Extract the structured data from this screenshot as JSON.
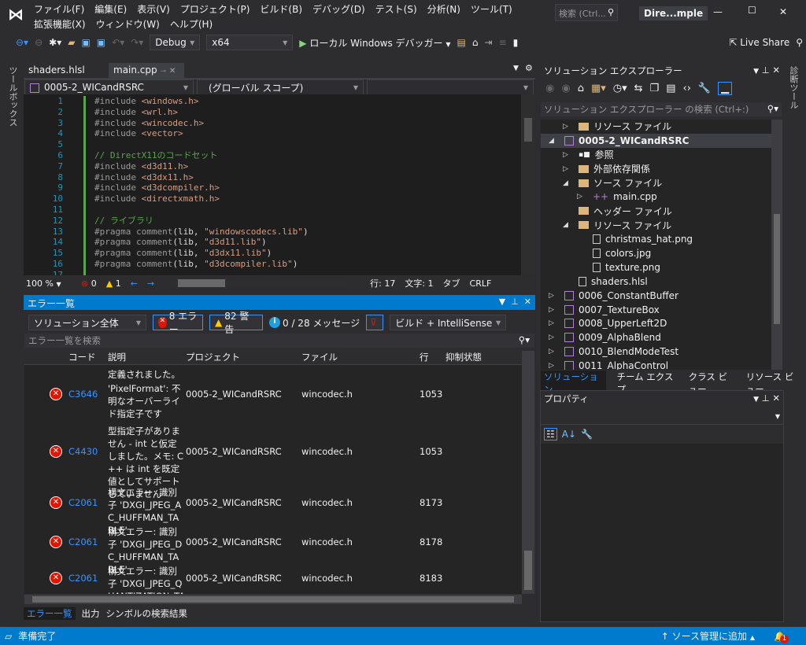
{
  "window": {
    "title": "Dire...mple",
    "search_placeholder": "検索 (Ctrl...",
    "min": "—",
    "max": "☐",
    "close": "✕"
  },
  "menu": [
    "ファイル(F)",
    "編集(E)",
    "表示(V)",
    "プロジェクト(P)",
    "ビルド(B)",
    "デバッグ(D)",
    "テスト(S)",
    "分析(N)",
    "ツール(T)",
    "拡張機能(X)",
    "ウィンドウ(W)",
    "ヘルプ(H)"
  ],
  "toolbar": {
    "config": "Debug",
    "platform": "x64",
    "debugger": "ローカル Windows デバッガー",
    "live_share": "Live Share"
  },
  "left_strip": "ツールボックス",
  "right_strip": "診断ツール",
  "doc_tabs": [
    {
      "label": "shaders.hlsl",
      "active": false
    },
    {
      "label": "main.cpp",
      "active": true
    }
  ],
  "nav": {
    "project": "0005-2_WICandRSRC",
    "scope": "(グローバル スコープ)",
    "member": ""
  },
  "code": [
    {
      "n": "1",
      "parts": [
        [
          "pp",
          "#include "
        ],
        [
          "inc",
          "<windows.h>"
        ]
      ]
    },
    {
      "n": "2",
      "parts": [
        [
          "pp",
          "#include "
        ],
        [
          "inc",
          "<wrl.h>"
        ]
      ]
    },
    {
      "n": "3",
      "parts": [
        [
          "pp",
          "#include "
        ],
        [
          "inc",
          "<wincodec.h>"
        ]
      ]
    },
    {
      "n": "4",
      "parts": [
        [
          "pp",
          "#include "
        ],
        [
          "inc",
          "<vector>"
        ]
      ]
    },
    {
      "n": "5",
      "parts": []
    },
    {
      "n": "6",
      "parts": [
        [
          "cm",
          "// DirectX11のコードセット"
        ]
      ]
    },
    {
      "n": "7",
      "parts": [
        [
          "pp",
          "#include "
        ],
        [
          "inc",
          "<d3d11.h>"
        ]
      ]
    },
    {
      "n": "8",
      "parts": [
        [
          "pp",
          "#include "
        ],
        [
          "inc",
          "<d3dx11.h>"
        ]
      ]
    },
    {
      "n": "9",
      "parts": [
        [
          "pp",
          "#include "
        ],
        [
          "inc",
          "<d3dcompiler.h>"
        ]
      ]
    },
    {
      "n": "10",
      "parts": [
        [
          "pp",
          "#include "
        ],
        [
          "inc",
          "<directxmath.h>"
        ]
      ]
    },
    {
      "n": "11",
      "parts": []
    },
    {
      "n": "12",
      "parts": [
        [
          "cm",
          "// ライブラリ"
        ]
      ]
    },
    {
      "n": "13",
      "parts": [
        [
          "pp",
          "#pragma comment"
        ],
        [
          "tx",
          "(lib, "
        ],
        [
          "inc",
          "\"windowscodecs.lib\""
        ],
        [
          "tx",
          ")"
        ]
      ]
    },
    {
      "n": "14",
      "parts": [
        [
          "pp",
          "#pragma comment"
        ],
        [
          "tx",
          "(lib, "
        ],
        [
          "inc",
          "\"d3d11.lib\""
        ],
        [
          "tx",
          ")"
        ]
      ]
    },
    {
      "n": "15",
      "parts": [
        [
          "pp",
          "#pragma comment"
        ],
        [
          "tx",
          "(lib, "
        ],
        [
          "inc",
          "\"d3dx11.lib\""
        ],
        [
          "tx",
          ")"
        ]
      ]
    },
    {
      "n": "16",
      "parts": [
        [
          "pp",
          "#pragma comment"
        ],
        [
          "tx",
          "(lib, "
        ],
        [
          "inc",
          "\"d3dcompiler.lib\""
        ],
        [
          "tx",
          ")"
        ]
      ]
    },
    {
      "n": "17",
      "parts": []
    }
  ],
  "editor_status": {
    "zoom": "100 %",
    "errors": "0",
    "warnings": "1",
    "line": "行: 17",
    "char": "文字: 1",
    "tab": "タブ",
    "eol": "CRLF"
  },
  "error_list": {
    "title": "エラー一覧",
    "scope": "ソリューション全体",
    "errors_btn": "8 エラー",
    "warnings_btn": "82 警告",
    "messages_btn": "0 / 28 メッセージ",
    "source": "ビルド + IntelliSense",
    "search_placeholder": "エラー一覧を検索",
    "columns": [
      "コード",
      "説明",
      "プロジェクト",
      "ファイル",
      "行",
      "抑制状態"
    ],
    "partial_top": "定義されました。",
    "rows": [
      {
        "code": "C3646",
        "desc": "'PixelFormat': 不明なオーバーライド指定子です",
        "project": "0005-2_WICandRSRC",
        "file": "wincodec.h",
        "line": "1053"
      },
      {
        "code": "C4430",
        "desc": "型指定子がありません - int と仮定しました。メモ: C++ は int を既定値としてサポートしていません",
        "project": "0005-2_WICandRSRC",
        "file": "wincodec.h",
        "line": "1053"
      },
      {
        "code": "C2061",
        "desc": "構文エラー: 識別子 'DXGI_JPEG_AC_HUFFMAN_TABLE'",
        "project": "0005-2_WICandRSRC",
        "file": "wincodec.h",
        "line": "8173"
      },
      {
        "code": "C2061",
        "desc": "構文エラー: 識別子 'DXGI_JPEG_DC_HUFFMAN_TABLE'",
        "project": "0005-2_WICandRSRC",
        "file": "wincodec.h",
        "line": "8178"
      },
      {
        "code": "C2061",
        "desc": "構文エラー: 識別子 'DXGI_JPEG_QUANTIZATION_TABLE'",
        "project": "0005-2_WICandRSRC",
        "file": "wincodec.h",
        "line": "8183"
      }
    ],
    "bottom_tabs": [
      "エラー一覧",
      "出力",
      "シンボルの検索結果"
    ]
  },
  "solution_explorer": {
    "title": "ソリューション エクスプローラー",
    "search_placeholder": "ソリューション エクスプローラー の検索 (Ctrl+:)",
    "tree": [
      {
        "label": "リソース ファイル",
        "indent": 1,
        "exp": "▷",
        "icon": "folder"
      },
      {
        "label": "0005-2_WICandRSRC",
        "indent": 0,
        "exp": "◢",
        "icon": "project",
        "selected": true,
        "bold": true
      },
      {
        "label": "参照",
        "indent": 1,
        "exp": "▷",
        "icon": "ref"
      },
      {
        "label": "外部依存関係",
        "indent": 1,
        "exp": "▷",
        "icon": "folder"
      },
      {
        "label": "ソース ファイル",
        "indent": 1,
        "exp": "◢",
        "icon": "folder"
      },
      {
        "label": "main.cpp",
        "indent": 2,
        "exp": "▷",
        "icon": "cpp"
      },
      {
        "label": "ヘッダー ファイル",
        "indent": 1,
        "exp": "",
        "icon": "folder"
      },
      {
        "label": "リソース ファイル",
        "indent": 1,
        "exp": "◢",
        "icon": "folder"
      },
      {
        "label": "christmas_hat.png",
        "indent": 2,
        "exp": "",
        "icon": "file"
      },
      {
        "label": "colors.jpg",
        "indent": 2,
        "exp": "",
        "icon": "file"
      },
      {
        "label": "texture.png",
        "indent": 2,
        "exp": "",
        "icon": "file"
      },
      {
        "label": "shaders.hlsl",
        "indent": 1,
        "exp": "",
        "icon": "file"
      },
      {
        "label": "0006_ConstantBuffer",
        "indent": 0,
        "exp": "▷",
        "icon": "project"
      },
      {
        "label": "0007_TextureBox",
        "indent": 0,
        "exp": "▷",
        "icon": "project"
      },
      {
        "label": "0008_UpperLeft2D",
        "indent": 0,
        "exp": "▷",
        "icon": "project"
      },
      {
        "label": "0009_AlphaBlend",
        "indent": 0,
        "exp": "▷",
        "icon": "project"
      },
      {
        "label": "0010_BlendModeTest",
        "indent": 0,
        "exp": "▷",
        "icon": "project"
      },
      {
        "label": "0011_AlphaControl",
        "indent": 0,
        "exp": "▷",
        "icon": "project"
      }
    ],
    "tabs": [
      "ソリューション...",
      "チーム エクスプ...",
      "クラス ビュー",
      "リソース ビュー"
    ]
  },
  "properties": {
    "title": "プロパティ"
  },
  "status_bar": {
    "text": "準備完了",
    "source_control": "ソース管理に追加",
    "notifications": "1",
    "color": "#007acc"
  }
}
